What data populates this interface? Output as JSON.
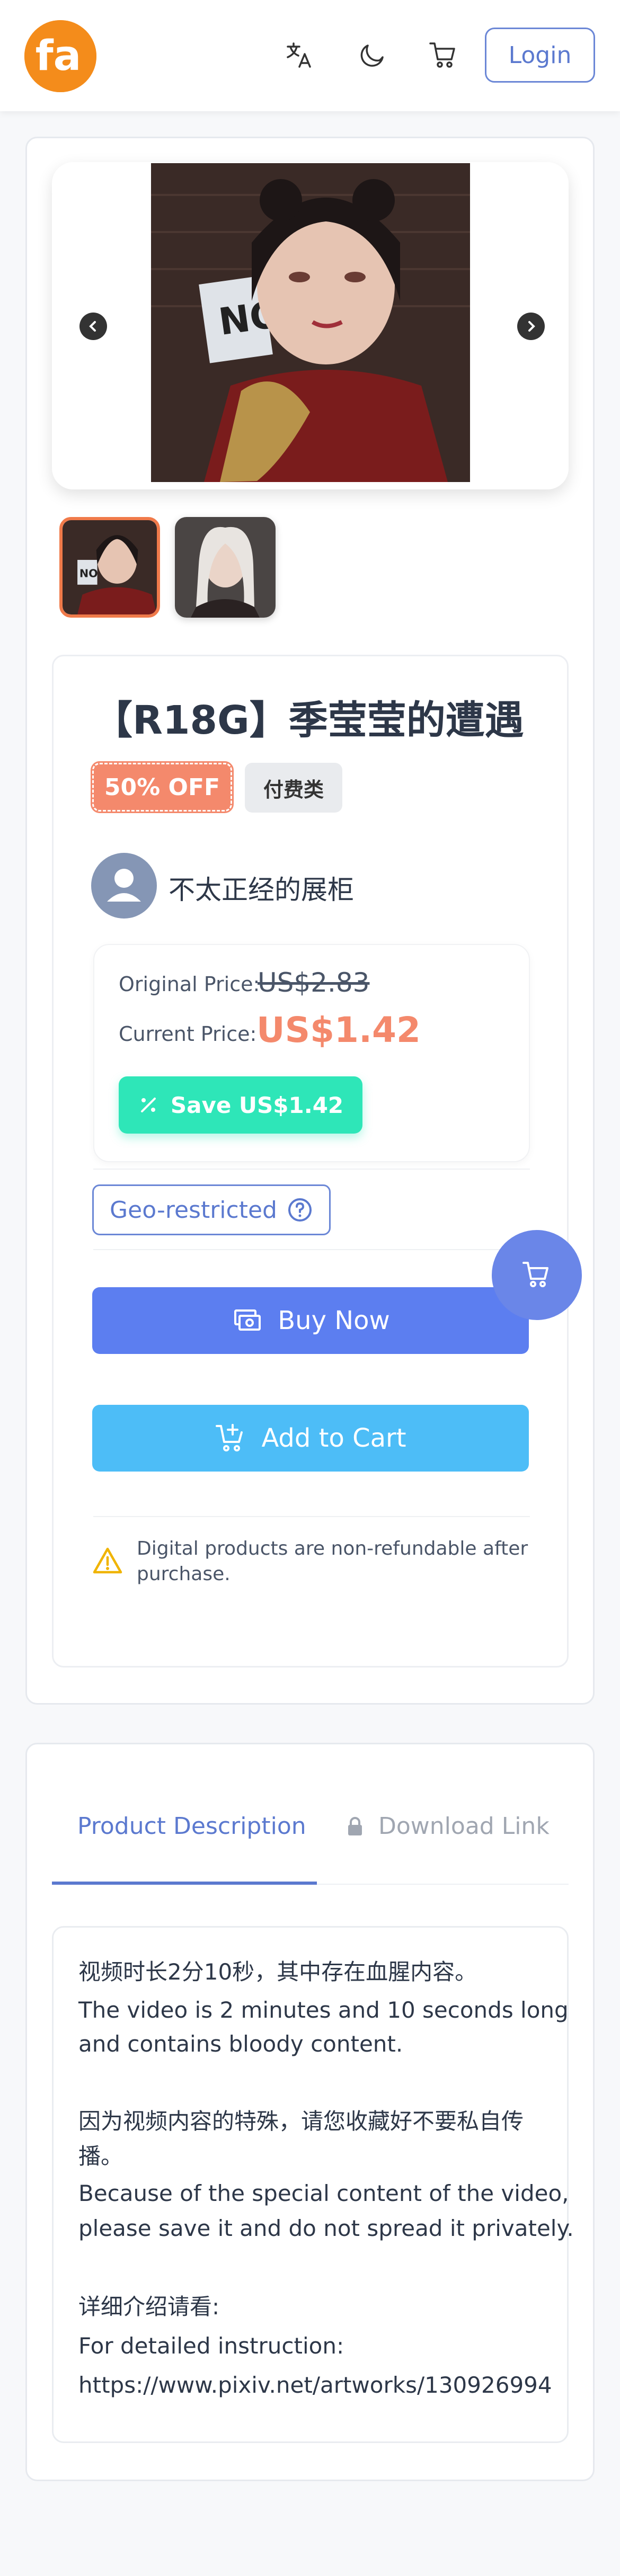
{
  "header": {
    "logo_text": "fa",
    "login_label": "Login",
    "icons": [
      "translate-icon",
      "moon-icon",
      "cart-icon"
    ]
  },
  "product": {
    "title": "【R18G】季莹莹的遭遇",
    "discount_badge": "50% OFF",
    "category_badge": "付费类",
    "seller_name": "不太正经的展柜",
    "original_price_label": "Original Price:",
    "original_price": "US$2.83",
    "current_price_label": "Current Price:",
    "current_price": "US$1.42",
    "save_label": "Save US$1.42",
    "geo_label": "Geo-restricted",
    "buy_now_label": "Buy Now",
    "add_to_cart_label": "Add to Cart",
    "notice": "Digital products are non-refundable after purchase."
  },
  "tabs": [
    {
      "label": "Product Description",
      "active": true
    },
    {
      "label": "Download Link",
      "active": false,
      "icon": "lock-icon"
    }
  ],
  "description": {
    "lines": [
      "视频时长2分10秒，其中存在血腥内容。",
      "The video is 2 minutes and 10 seconds long",
      "and contains bloody content.",
      "",
      "因为视频内容的特殊，请您收藏好不要私自传",
      "播。",
      "Because of the special content of the video,",
      "please save it and do not spread it privately.",
      "",
      "详细介绍请看:",
      "For detailed instruction:",
      "https://www.pixiv.net/artworks/130926994"
    ]
  },
  "colors": {
    "accent": "#5c7ef0",
    "price": "#f4896c",
    "save": "#2ee6b8",
    "cart": "#4dbdf7",
    "logo": "#f48c1b"
  }
}
